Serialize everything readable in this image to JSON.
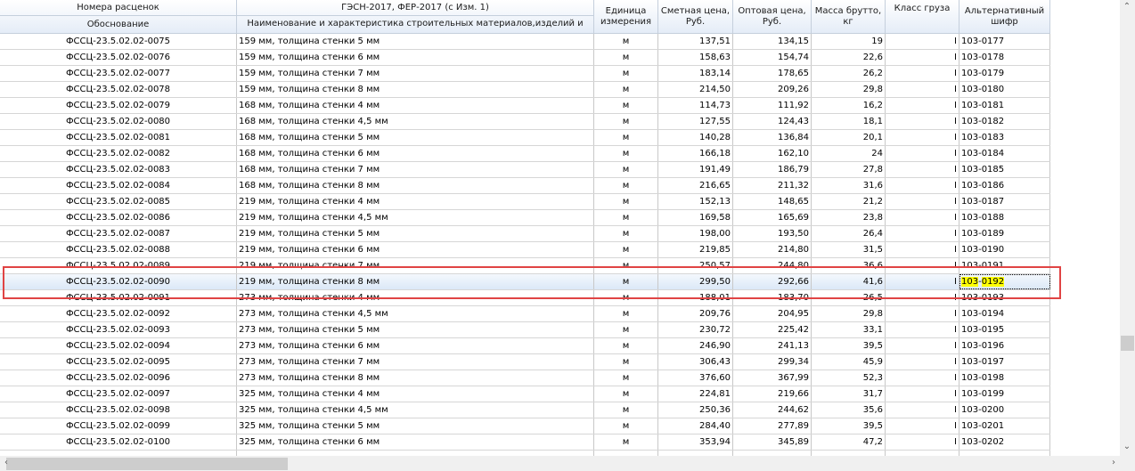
{
  "header": {
    "group1": "Номера расценок",
    "group2": "ГЭСН-2017, ФЕР-2017 (с Изм. 1)",
    "col_code": "Обоснование",
    "col_name": "Наименование и характеристика строительных материалов,изделий и",
    "col_unit": "Единица измерения",
    "col_est": "Сметная цена, Руб.",
    "col_whole": "Оптовая цена, Руб.",
    "col_mass": "Масса брутто, кг",
    "col_class": "Класс груза",
    "col_alt": "Альтернативный шифр"
  },
  "rows": [
    [
      "ФССЦ-23.5.02.02-0075",
      "159 мм, толщина стенки 5 мм",
      "м",
      "137,51",
      "134,15",
      "19",
      "I",
      "103-0177"
    ],
    [
      "ФССЦ-23.5.02.02-0076",
      "159 мм, толщина стенки 6 мм",
      "м",
      "158,63",
      "154,74",
      "22,6",
      "I",
      "103-0178"
    ],
    [
      "ФССЦ-23.5.02.02-0077",
      "159 мм, толщина стенки 7 мм",
      "м",
      "183,14",
      "178,65",
      "26,2",
      "I",
      "103-0179"
    ],
    [
      "ФССЦ-23.5.02.02-0078",
      "159 мм, толщина стенки 8 мм",
      "м",
      "214,50",
      "209,26",
      "29,8",
      "I",
      "103-0180"
    ],
    [
      "ФССЦ-23.5.02.02-0079",
      "168 мм, толщина стенки 4 мм",
      "м",
      "114,73",
      "111,92",
      "16,2",
      "I",
      "103-0181"
    ],
    [
      "ФССЦ-23.5.02.02-0080",
      "168 мм, толщина стенки 4,5 мм",
      "м",
      "127,55",
      "124,43",
      "18,1",
      "I",
      "103-0182"
    ],
    [
      "ФССЦ-23.5.02.02-0081",
      "168 мм, толщина стенки 5 мм",
      "м",
      "140,28",
      "136,84",
      "20,1",
      "I",
      "103-0183"
    ],
    [
      "ФССЦ-23.5.02.02-0082",
      "168 мм, толщина стенки 6 мм",
      "м",
      "166,18",
      "162,10",
      "24",
      "I",
      "103-0184"
    ],
    [
      "ФССЦ-23.5.02.02-0083",
      "168 мм, толщина стенки 7 мм",
      "м",
      "191,49",
      "186,79",
      "27,8",
      "I",
      "103-0185"
    ],
    [
      "ФССЦ-23.5.02.02-0084",
      "168 мм, толщина стенки 8 мм",
      "м",
      "216,65",
      "211,32",
      "31,6",
      "I",
      "103-0186"
    ],
    [
      "ФССЦ-23.5.02.02-0085",
      "219 мм, толщина стенки 4 мм",
      "м",
      "152,13",
      "148,65",
      "21,2",
      "I",
      "103-0187"
    ],
    [
      "ФССЦ-23.5.02.02-0086",
      "219 мм, толщина стенки 4,5 мм",
      "м",
      "169,58",
      "165,69",
      "23,8",
      "I",
      "103-0188"
    ],
    [
      "ФССЦ-23.5.02.02-0087",
      "219 мм, толщина стенки 5 мм",
      "м",
      "198,00",
      "193,50",
      "26,4",
      "I",
      "103-0189"
    ],
    [
      "ФССЦ-23.5.02.02-0088",
      "219 мм, толщина стенки 6 мм",
      "м",
      "219,85",
      "214,80",
      "31,5",
      "I",
      "103-0190"
    ],
    [
      "ФССЦ-23.5.02.02-0089",
      "219 мм, толщина стенки 7 мм",
      "м",
      "250,57",
      "244,80",
      "36,6",
      "I",
      "103-0191"
    ],
    [
      "ФССЦ-23.5.02.02-0090",
      "219 мм, толщина стенки 8 мм",
      "м",
      "299,50",
      "292,66",
      "41,6",
      "I",
      "103-0192"
    ],
    [
      "ФССЦ-23.5.02.02-0091",
      "273 мм, толщина стенки 4 мм",
      "м",
      "188,01",
      "183,70",
      "26,5",
      "I",
      "103-0193"
    ],
    [
      "ФССЦ-23.5.02.02-0092",
      "273 мм, толщина стенки 4,5 мм",
      "м",
      "209,76",
      "204,95",
      "29,8",
      "I",
      "103-0194"
    ],
    [
      "ФССЦ-23.5.02.02-0093",
      "273 мм, толщина стенки 5 мм",
      "м",
      "230,72",
      "225,42",
      "33,1",
      "I",
      "103-0195"
    ],
    [
      "ФССЦ-23.5.02.02-0094",
      "273 мм, толщина стенки 6 мм",
      "м",
      "246,90",
      "241,13",
      "39,5",
      "I",
      "103-0196"
    ],
    [
      "ФССЦ-23.5.02.02-0095",
      "273 мм, толщина стенки 7 мм",
      "м",
      "306,43",
      "299,34",
      "45,9",
      "I",
      "103-0197"
    ],
    [
      "ФССЦ-23.5.02.02-0096",
      "273 мм, толщина стенки 8 мм",
      "м",
      "376,60",
      "367,99",
      "52,3",
      "I",
      "103-0198"
    ],
    [
      "ФССЦ-23.5.02.02-0097",
      "325 мм, толщина стенки 4 мм",
      "м",
      "224,81",
      "219,66",
      "31,7",
      "I",
      "103-0199"
    ],
    [
      "ФССЦ-23.5.02.02-0098",
      "325 мм, толщина стенки 4,5 мм",
      "м",
      "250,36",
      "244,62",
      "35,6",
      "I",
      "103-0200"
    ],
    [
      "ФССЦ-23.5.02.02-0099",
      "325 мм, толщина стенки 5 мм",
      "м",
      "284,40",
      "277,89",
      "39,5",
      "I",
      "103-0201"
    ],
    [
      "ФССЦ-23.5.02.02-0100",
      "325 мм, толщина стенки 6 мм",
      "м",
      "353,94",
      "345,89",
      "47,2",
      "I",
      "103-0202"
    ]
  ],
  "selected_row": 15,
  "search_highlight": [
    "103",
    "0192"
  ],
  "colors": {
    "highlight": "#ffff00",
    "annotation": "#e04444"
  }
}
